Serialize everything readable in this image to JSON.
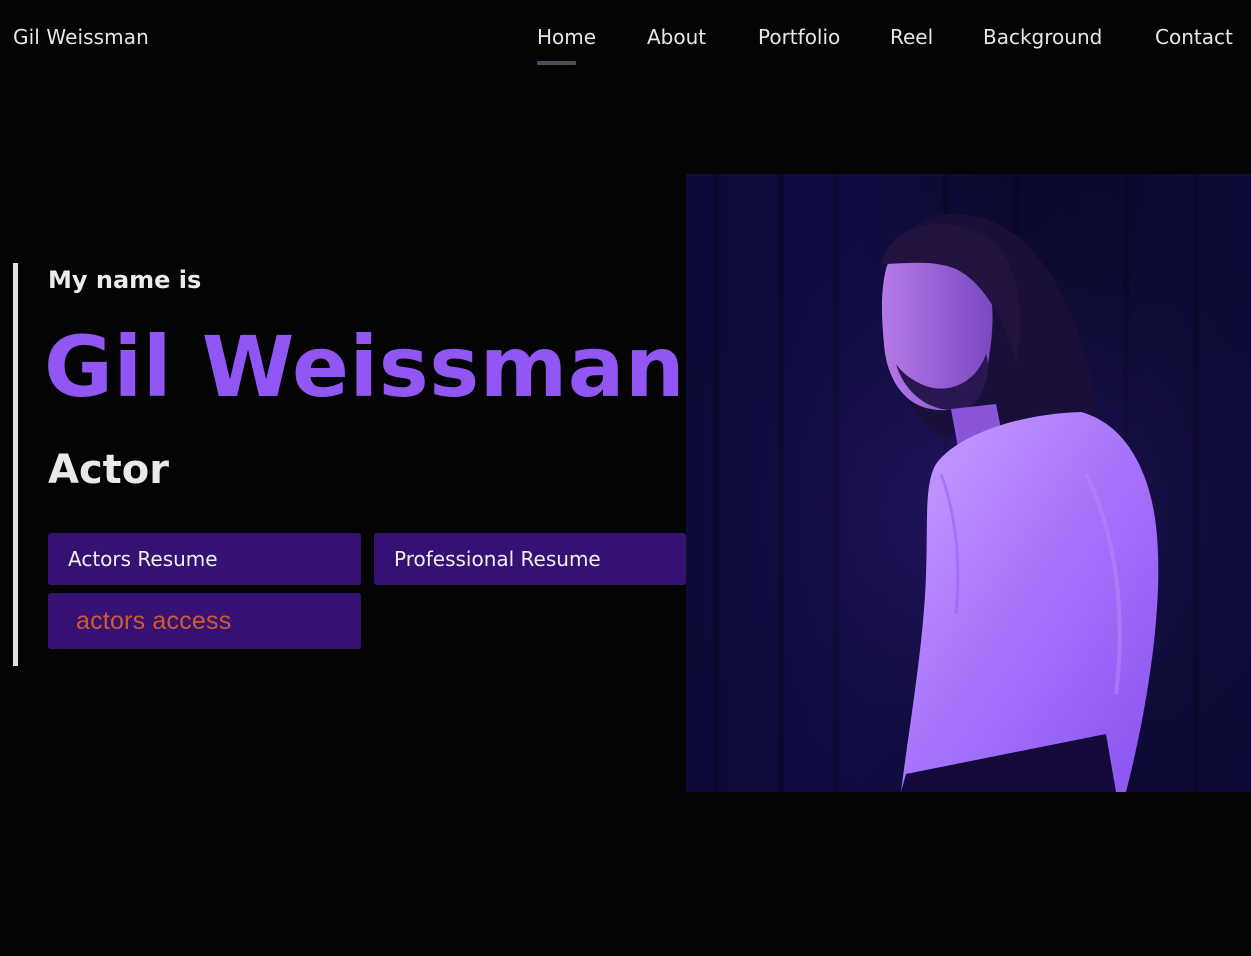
{
  "header": {
    "site_name": "Gil Weissman",
    "nav": [
      {
        "label": "Home",
        "active": true
      },
      {
        "label": "About",
        "active": false
      },
      {
        "label": "Portfolio",
        "active": false
      },
      {
        "label": "Reel",
        "active": false
      },
      {
        "label": "Background",
        "active": false
      },
      {
        "label": "Contact",
        "active": false
      }
    ]
  },
  "hero": {
    "intro": "My name is",
    "name": "Gil Weissman",
    "role": "Actor",
    "buttons": {
      "actors_resume": "Actors Resume",
      "professional_resume": "Professional Resume",
      "actors_access": "actors access"
    }
  },
  "colors": {
    "accent_purple": "#9256f5",
    "button_bg": "#361174",
    "actors_access_text": "#d05a2e",
    "background": "#040404"
  },
  "icons": {
    "portrait": "portrait-photo"
  }
}
